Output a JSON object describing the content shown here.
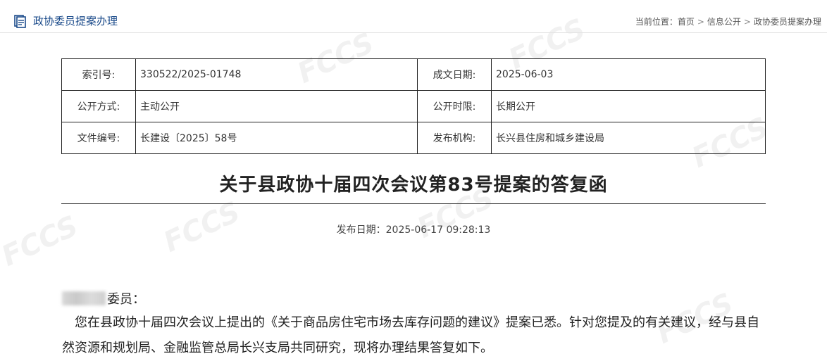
{
  "header": {
    "section_title": "政协委员提案办理",
    "breadcrumb": {
      "prefix": "当前位置：",
      "items": [
        "首页",
        "信息公开",
        "政协委员提案办理"
      ],
      "separator": ">"
    }
  },
  "meta_table": {
    "rows": [
      {
        "k1": "索引号:",
        "v1": "330522/2025-01748",
        "k2": "成文日期:",
        "v2": "2025-06-03"
      },
      {
        "k1": "公开方式:",
        "v1": "主动公开",
        "k2": "公开时限:",
        "v2": "长期公开"
      },
      {
        "k1": "文件编号:",
        "v1": "长建设〔2025〕58号",
        "k2": "发布机构:",
        "v2": "长兴县住房和城乡建设局"
      }
    ]
  },
  "document": {
    "title": "关于县政协十届四次会议第83号提案的答复函",
    "publish_date": "发布日期：2025-06-17 09:28:13",
    "greeting_suffix": "委员：",
    "paragraph": "您在县政协十届四次会议上提出的《关于商品房住宅市场去库存问题的建议》提案已悉。针对您提及的有关建议，经与县自然资源和规划局、金融监管总局长兴支局共同研究，现将办理结果答复如下。"
  },
  "colors": {
    "accent": "#1a4a8a"
  }
}
